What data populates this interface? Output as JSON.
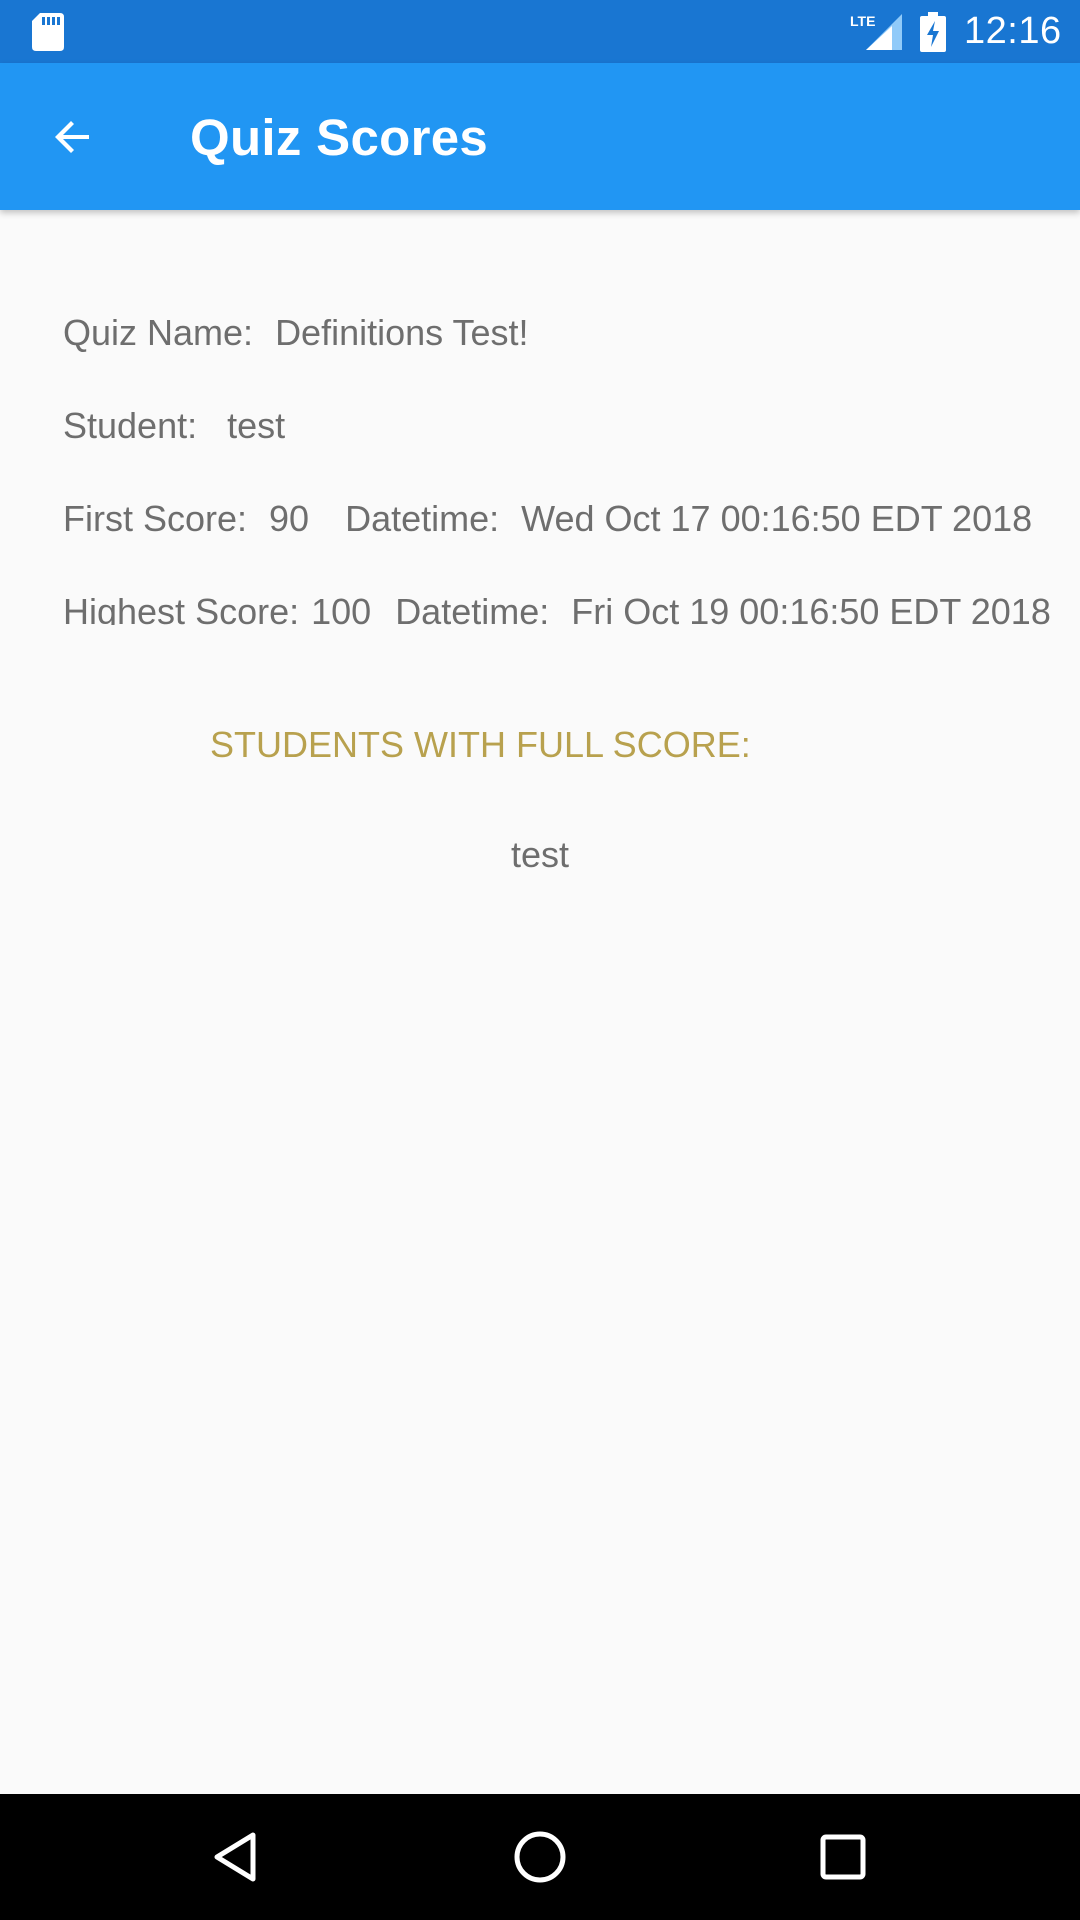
{
  "status_bar": {
    "time": "12:16",
    "network_label": "LTE",
    "icons": [
      "sd-card-icon",
      "lte-signal-icon",
      "battery-charging-icon"
    ],
    "color": "#1976d2"
  },
  "app_bar": {
    "title": "Quiz Scores",
    "back_icon": "arrow-back-icon",
    "color": "#2196f3"
  },
  "details": {
    "quiz_name_label": "Quiz Name:",
    "quiz_name_value": "Definitions Test!",
    "student_label": "Student:",
    "student_value": "test",
    "first_score_label": "First Score:",
    "first_score_value": "90",
    "first_datetime_label": "Datetime:",
    "first_datetime_value": "Wed Oct 17 00:16:50 EDT 2018",
    "highest_score_label": "Highest Score:",
    "highest_score_value": "100",
    "highest_datetime_label": "Datetime:",
    "highest_datetime_value": "Fri Oct 19 00:16:50 EDT 2018"
  },
  "full_score": {
    "heading": "STUDENTS WITH FULL SCORE:",
    "students": [
      "test"
    ],
    "heading_color": "#b8a14e"
  },
  "nav_bar": {
    "icons": [
      "back-triangle-icon",
      "home-circle-icon",
      "recents-square-icon"
    ]
  }
}
